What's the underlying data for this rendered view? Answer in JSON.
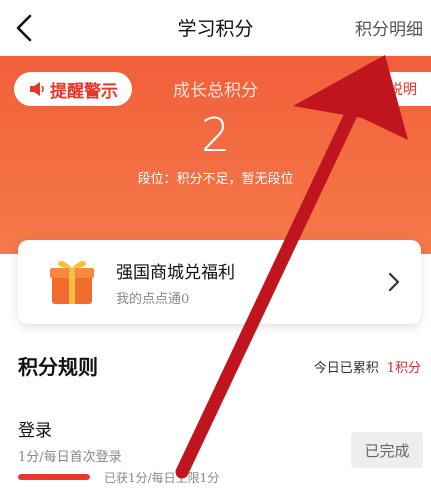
{
  "nav": {
    "title": "学习积分",
    "right_link": "积分明细"
  },
  "header": {
    "warning_label": "提醒警示",
    "total_label": "成长总积分",
    "total_value": "2",
    "rank_text": "段位：积分不足，暂无段位",
    "explain_label": "说明"
  },
  "mall_card": {
    "title": "强国商城兑福利",
    "subtitle": "我的点点通0"
  },
  "rules": {
    "title": "积分规则",
    "today_label": "今日已累积",
    "today_points": "1积分"
  },
  "login_rule": {
    "title": "登录",
    "subtitle": "1分/每日首次登录",
    "progress_fraction": 1.0,
    "progress_text": "已获1分/每日上限1分",
    "status_button": "已完成"
  },
  "colors": {
    "header_top": "#f25f3a",
    "accent_red": "#e8362a",
    "overlay_arrow": "#c0141e"
  },
  "icons": [
    "back-chevron-icon",
    "megaphone-icon",
    "gift-icon",
    "chevron-right-icon"
  ]
}
